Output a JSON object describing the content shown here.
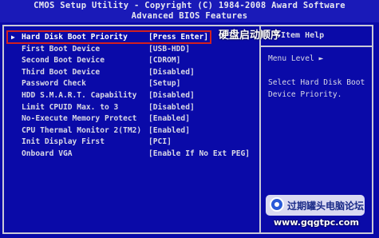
{
  "header": {
    "title": "CMOS Setup Utility - Copyright (C) 1984-2008 Award Software",
    "subtitle": "Advanced BIOS Features"
  },
  "settings": [
    {
      "label": "Hard Disk Boot Priority",
      "value": "[Press Enter]"
    },
    {
      "label": "First Boot Device",
      "value": "[USB-HDD]"
    },
    {
      "label": "Second Boot Device",
      "value": "[CDROM]"
    },
    {
      "label": "Third Boot Device",
      "value": "[Disabled]"
    },
    {
      "label": "Password Check",
      "value": "[Setup]"
    },
    {
      "label": "HDD S.M.A.R.T. Capability",
      "value": "[Disabled]"
    },
    {
      "label": "Limit CPUID Max. to 3",
      "value": "[Disabled]"
    },
    {
      "label": "No-Execute Memory Protect",
      "value": "[Enabled]"
    },
    {
      "label": "CPU Thermal Monitor 2(TM2)",
      "value": "[Enabled]"
    },
    {
      "label": "Init Display First",
      "value": "[PCI]"
    },
    {
      "label": "Onboard VGA",
      "value": "[Enable If No Ext PEG]"
    }
  ],
  "annotation": "硬盘启动顺序",
  "help": {
    "title": "Item Help",
    "menu_level": "Menu Level  ►",
    "description": "Select Hard Disk Boot Device Priority."
  },
  "watermark": {
    "text": "过期罐头电脑论坛",
    "url": "www.gqgtpc.com"
  },
  "colors": {
    "background": "#0a0aa8",
    "highlight_border": "#d22020",
    "text": "#d9d9e6"
  }
}
